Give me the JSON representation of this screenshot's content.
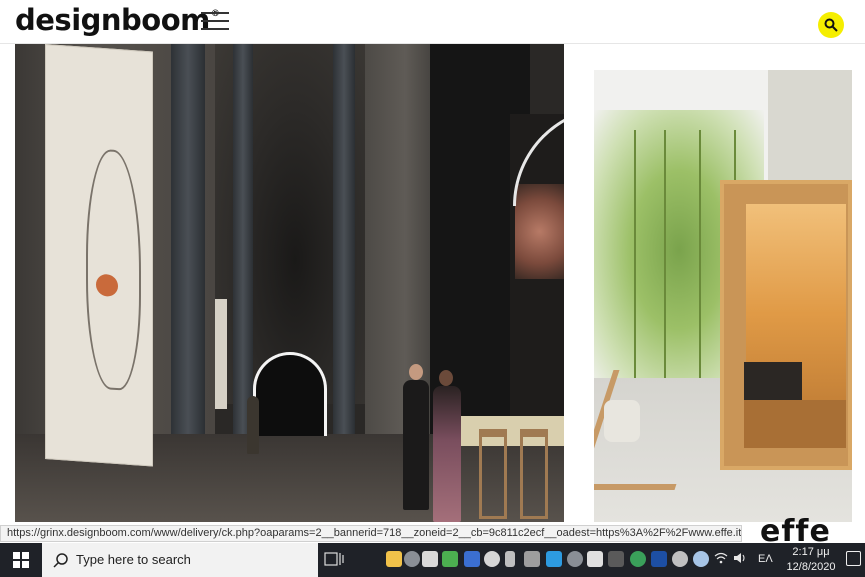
{
  "site": {
    "logo_text": "designboom",
    "logo_mark": "®"
  },
  "header": {
    "menu_icon": "hamburger-menu-icon",
    "search_icon": "search-icon",
    "search_color": "#f5ee00"
  },
  "ad": {
    "brand_logo": "effe"
  },
  "status_bar": {
    "url": "https://grinx.designboom.com/www/delivery/ck.php?oaparams=2__bannerid=718__zoneid=2__cb=9c811c2ecf__oadest=https%3A%2F%2Fwww.effe.it%2Fen%2F"
  },
  "taskbar": {
    "search_placeholder": "Type here to search",
    "language": "ΕΛ",
    "time": "2:17 μμ",
    "date": "12/8/2020",
    "pinned_icons": [
      "file-explorer-icon",
      "skype-icon",
      "security-icon",
      "game-icon",
      "word-icon",
      "onedrive-icon",
      "usb-icon",
      "media-icon",
      "app-icon",
      "skype-icon",
      "chat-icon",
      "hd-icon",
      "shield-icon",
      "network-icon",
      "edit-icon",
      "globe-icon",
      "document-icon",
      "person-icon",
      "messenger-icon"
    ]
  }
}
